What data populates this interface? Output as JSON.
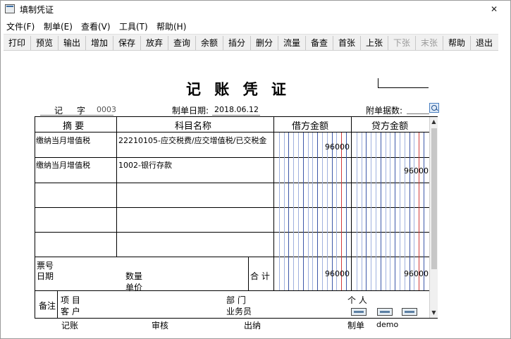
{
  "window": {
    "title": "填制凭证",
    "close": "✕"
  },
  "menu": [
    "文件(F)",
    "制单(E)",
    "查看(V)",
    "工具(T)",
    "帮助(H)"
  ],
  "toolbar": [
    {
      "label": "打印",
      "enabled": true
    },
    {
      "label": "预览",
      "enabled": true
    },
    {
      "label": "输出",
      "enabled": true
    },
    {
      "label": "增加",
      "enabled": true
    },
    {
      "label": "保存",
      "enabled": true
    },
    {
      "label": "放弃",
      "enabled": true
    },
    {
      "label": "查询",
      "enabled": true
    },
    {
      "label": "余额",
      "enabled": true
    },
    {
      "label": "插分",
      "enabled": true
    },
    {
      "label": "删分",
      "enabled": true
    },
    {
      "label": "流量",
      "enabled": true
    },
    {
      "label": "备查",
      "enabled": true
    },
    {
      "label": "首张",
      "enabled": true
    },
    {
      "label": "上张",
      "enabled": true
    },
    {
      "label": "下张",
      "enabled": false
    },
    {
      "label": "末张",
      "enabled": false
    },
    {
      "label": "帮助",
      "enabled": true
    },
    {
      "label": "退出",
      "enabled": true
    }
  ],
  "voucher": {
    "title": "记 账 凭 证",
    "type_label": "记",
    "number_label": "字",
    "number": "0003",
    "date_label": "制单日期:",
    "date": "2018.06.12",
    "attachments_label": "附单据数:"
  },
  "columns": {
    "summary": "摘  要",
    "account": "科目名称",
    "debit": "借方金额",
    "credit": "贷方金额"
  },
  "entries": [
    {
      "summary": "缴纳当月增值税",
      "account": "22210105-应交税费/应交增值税/已交税金",
      "debit": "96000",
      "credit": ""
    },
    {
      "summary": "缴纳当月增值税",
      "account": "1002-银行存款",
      "debit": "",
      "credit": "96000"
    },
    {
      "summary": "",
      "account": "",
      "debit": "",
      "credit": ""
    },
    {
      "summary": "",
      "account": "",
      "debit": "",
      "credit": ""
    },
    {
      "summary": "",
      "account": "",
      "debit": "",
      "credit": ""
    }
  ],
  "totals": {
    "ticket_label": "票号",
    "date_label": "日期",
    "qty_label": "数量",
    "price_label": "单价",
    "total_label": "合 计",
    "debit_total": "96000",
    "credit_total": "96000"
  },
  "notes": {
    "label": "备注",
    "project_label": "项  目",
    "customer_label": "客  户",
    "dept_label": "部  门",
    "staff_label": "业务员",
    "person_label": "个  人"
  },
  "footer": {
    "bookkeeper_label": "记账",
    "reviewer_label": "审核",
    "cashier_label": "出纳",
    "maker_label": "制单",
    "maker": "demo"
  }
}
